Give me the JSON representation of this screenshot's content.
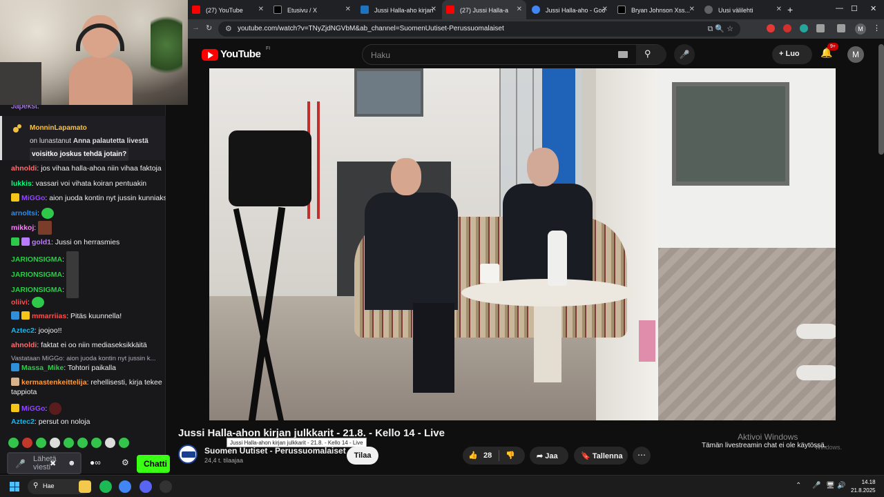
{
  "chat": {
    "cut_username": "Japekst:",
    "redeem": {
      "user": "MonninLapamato",
      "text_pre": "on lunastanut",
      "reward": "Anna palautetta livestä",
      "question": "voisitko joskus tehdä jotain?"
    },
    "messages": [
      {
        "user": "ahnoldi",
        "color": "#ff6b6b",
        "text": "jos vihaa halla-ahoa niin vihaa faktoja"
      },
      {
        "user": "lukkis",
        "color": "#00ff7f",
        "text": "vassari voi vihata koiran pentuakin"
      },
      {
        "user": "MiGGo",
        "color": "#9146ff",
        "text": "aion juoda kontin nyt jussin kunniaksi"
      },
      {
        "user": "arnoltsi",
        "color": "#1e90ff",
        "text": ""
      },
      {
        "user": "mikkoj",
        "color": "#ff7eff",
        "text": ""
      },
      {
        "user": "gold1",
        "color": "#b97cff",
        "text": "Jussi on herrasmies"
      },
      {
        "user": "JARIONSIGMA",
        "color": "#2ec94a",
        "text": ""
      },
      {
        "user": "JARIONSIGMA",
        "color": "#2ec94a",
        "text": ""
      },
      {
        "user": "JARIONSIGMA",
        "color": "#2ec94a",
        "text": ""
      },
      {
        "user": "oliivi",
        "color": "#ff4d4d",
        "text": ""
      },
      {
        "user": "mmarriias",
        "color": "#ff4d4d",
        "text": "Pitäs kuunnella!"
      },
      {
        "user": "Aztec2",
        "color": "#00bfff",
        "text": "joojoo!!"
      },
      {
        "user": "ahnoldi",
        "color": "#ff6b6b",
        "text": "faktat ei oo niin mediaseksikkäitä"
      },
      {
        "user": "Massa_Mike",
        "color": "#2ec94a",
        "text": "Tohtori paikalla"
      },
      {
        "user": "kermastenkeittelija",
        "color": "#ff9b3d",
        "text": "rehellisesti, kirja tekee"
      },
      {
        "user": "MiGGo",
        "color": "#9146ff",
        "text": ""
      },
      {
        "user": "Aztec2",
        "color": "#00bfff",
        "text": "persut on noloja"
      }
    ],
    "reply_hint": "Vastataan MiGGo: aion juoda kontin nyt jussin k...",
    "wrap_line": "tappiota",
    "input_placeholder": "Lähetä viesti",
    "points": "∞",
    "chat_button": "Chatti"
  },
  "browser": {
    "tabs": [
      {
        "label": "(27) YouTube",
        "fav": "#ff0000"
      },
      {
        "label": "Etusivu / X",
        "fav": "#000000"
      },
      {
        "label": "Jussi Halla-aho kirjan",
        "fav": "#1e73be"
      },
      {
        "label": "(27) Jussi Halla-a",
        "fav": "#ff0000",
        "active": true
      },
      {
        "label": "Jussi Halla-aho - Goo",
        "fav": "#4285f4"
      },
      {
        "label": "Bryan Johnson Xss...",
        "fav": "#000000"
      },
      {
        "label": "Uusi välilehti",
        "fav": "#5f6368"
      }
    ],
    "url": "youtube.com/watch?v=TNyZjdNGVbM&ab_channel=SuomenUutiset-Perussuomalaiset",
    "profile_initial": "M"
  },
  "youtube": {
    "logo_text": "YouTube",
    "country": "FI",
    "search_placeholder": "Haku",
    "create_label": "Luo",
    "notif_count": "9+",
    "avatar_initial": "M",
    "video_title": "Jussi Halla-ahon kirjan julkkarit - 21.8. - Kello 14 - Live",
    "tooltip": "Jussi Halla-ahon kirjan julkkarit - 21.8. - Kello 14 - Live",
    "channel_name": "Suomen Uutiset - Perussuomalaiset",
    "subscribers": "24,4 t. tilaajaa",
    "subscribe_label": "Tilaa",
    "likes": "28",
    "share_label": "Jaa",
    "save_label": "Tallenna",
    "chat_disabled": "Tämän livestreamin chat ei ole käytössä.",
    "activate_windows": "Aktivoi Windows",
    "activate_windows_sub": "Windows."
  },
  "taskbar": {
    "search_label": "Hae",
    "time": "14.18",
    "date": "21.8.2025",
    "discord_badge": "9+"
  }
}
